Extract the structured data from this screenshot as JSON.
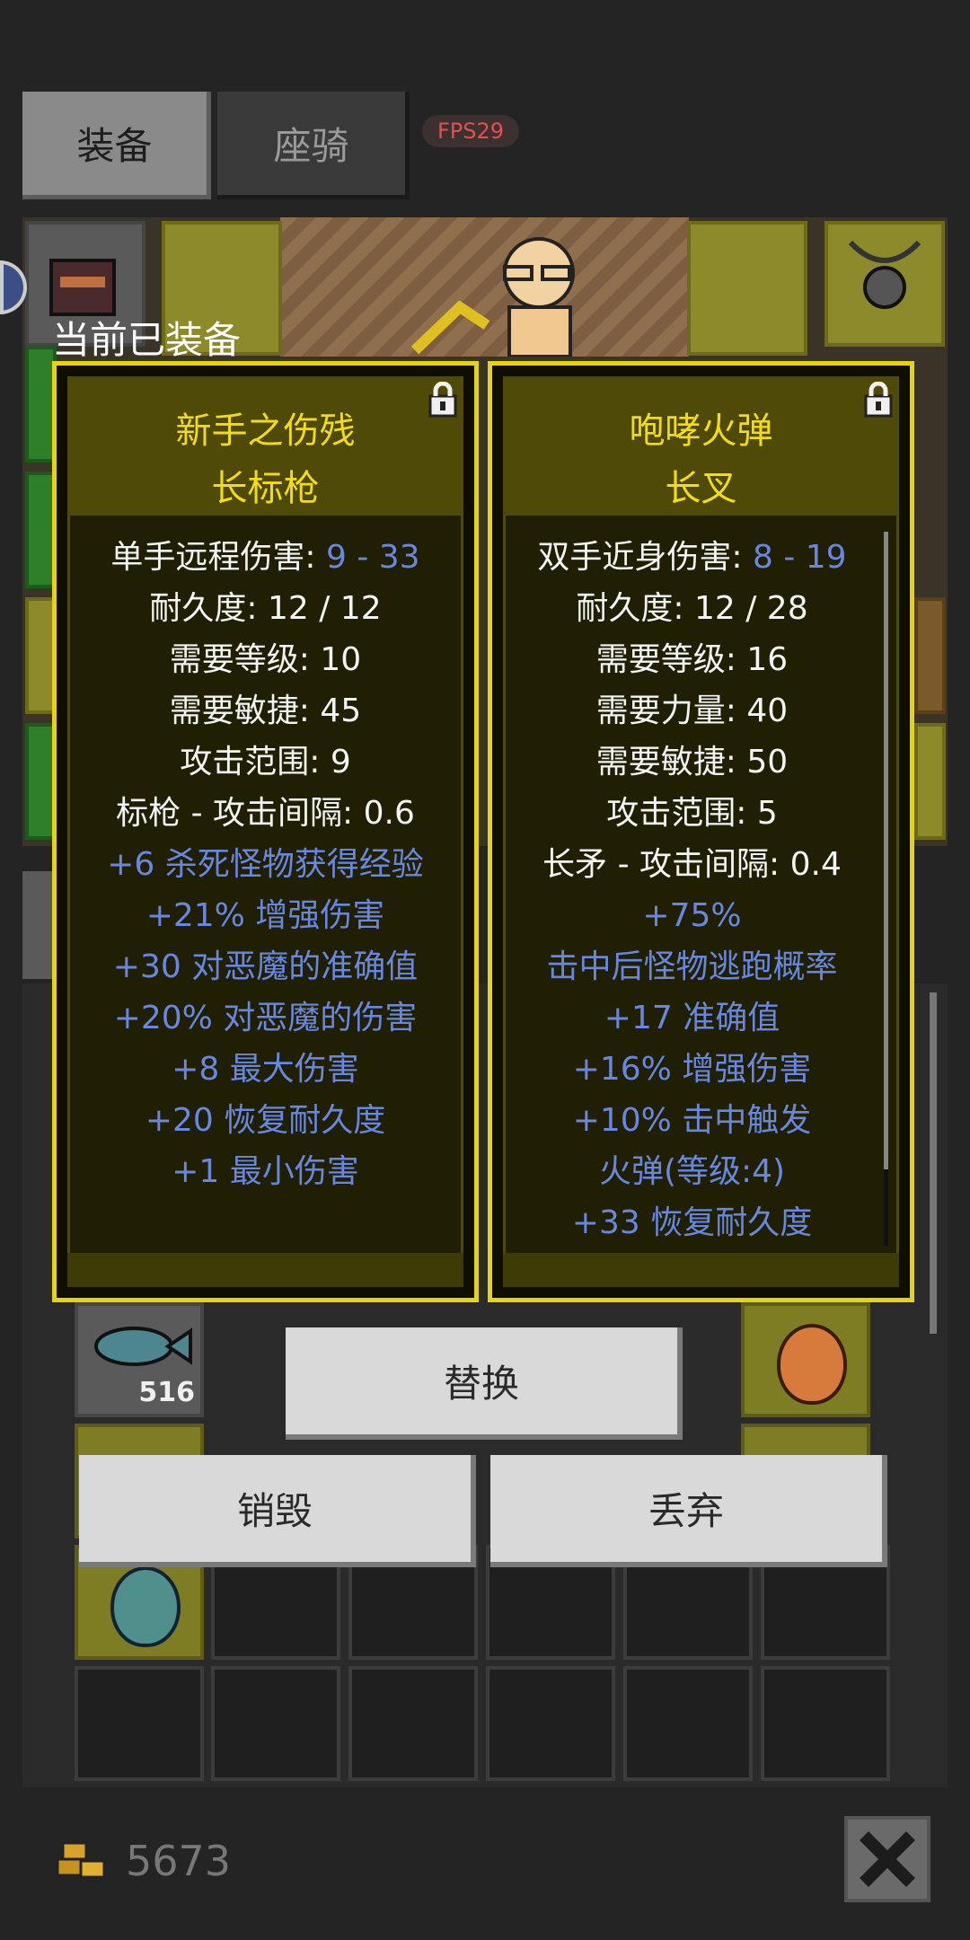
{
  "tabs": {
    "equipment": "装备",
    "mount": "座骑"
  },
  "fps": "FPS29",
  "currently_equipped_label": "当前已装备",
  "left_item": {
    "name_line1": "新手之伤残",
    "name_line2": "长标枪",
    "stats": [
      {
        "label": "单手远程伤害: ",
        "value": "9 - 33"
      },
      {
        "text": "耐久度: 12 / 12"
      },
      {
        "text": "需要等级: 10"
      },
      {
        "text": "需要敏捷: 45"
      },
      {
        "text": "攻击范围: 9"
      },
      {
        "text": "标枪 - 攻击间隔: 0.6"
      }
    ],
    "affixes": [
      "+6 杀死怪物获得经验",
      "+21% 增强伤害",
      "+30 对恶魔的准确值",
      "+20% 对恶魔的伤害",
      "+8 最大伤害",
      "+20 恢复耐久度",
      "+1 最小伤害"
    ]
  },
  "right_item": {
    "name_line1": "咆哮火弹",
    "name_line2": "长叉",
    "stats": [
      {
        "label": "双手近身伤害: ",
        "value": "8 - 19"
      },
      {
        "text": "耐久度: 12 / 28"
      },
      {
        "text": "需要等级: 16"
      },
      {
        "text": "需要力量: 40"
      },
      {
        "text": "需要敏捷: 50"
      },
      {
        "text": "攻击范围: 5"
      },
      {
        "text": "长矛 - 攻击间隔: 0.4"
      }
    ],
    "affixes": [
      "+75%",
      "击中后怪物逃跑概率",
      "+17 准确值",
      "+16% 增强伤害",
      "+10% 击中触发",
      "火弹(等级:4)",
      "+33 恢复耐久度"
    ]
  },
  "inventory": {
    "fish_count": "516"
  },
  "buttons": {
    "replace": "替换",
    "destroy": "销毁",
    "discard": "丢弃"
  },
  "gold": "5673",
  "colors": {
    "title_yellow": "#f2dc18",
    "affix_blue": "#6888e0",
    "panel_border": "#e5d21a"
  }
}
